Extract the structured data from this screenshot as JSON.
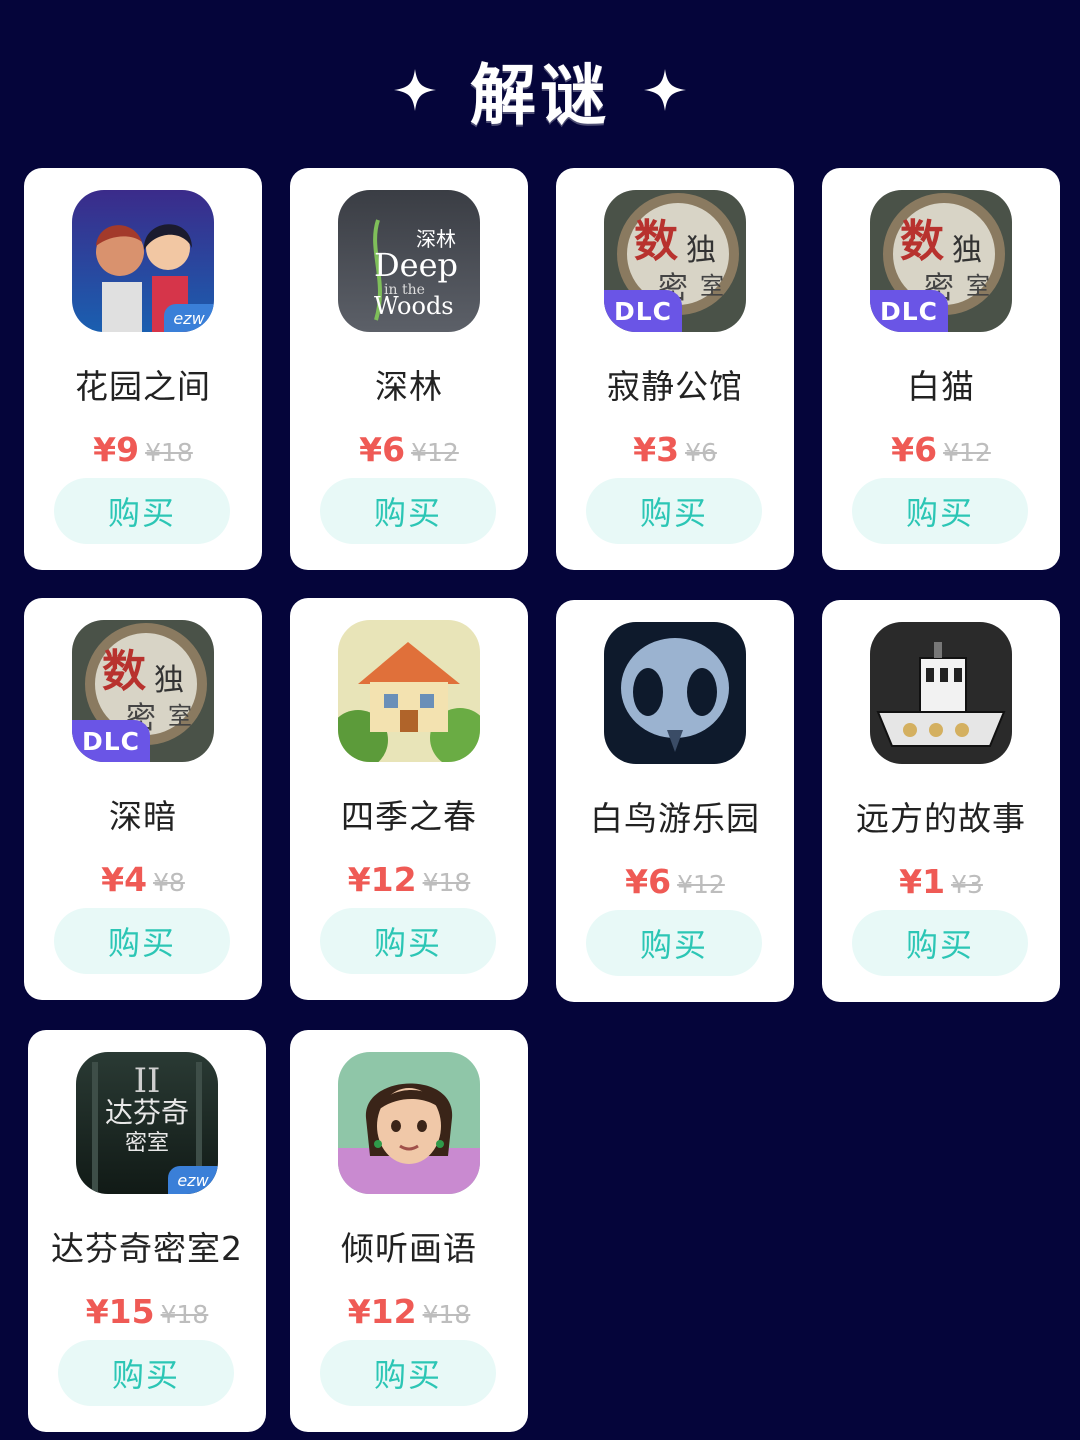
{
  "header": {
    "title": "解谜"
  },
  "buy_label": "购买",
  "colors": {
    "background": "#05053a",
    "price": "#ef5a55",
    "button_text": "#2cc6b5",
    "button_bg": "#e8f9f7",
    "dlc_badge": "#6a55e6"
  },
  "games": [
    {
      "name": "花园之间",
      "price": "¥9",
      "old_price": "¥18",
      "badge": "ezw",
      "icon": "garden-between-icon"
    },
    {
      "name": "深林",
      "price": "¥6",
      "old_price": "¥12",
      "badge": "",
      "icon": "deep-in-the-woods-icon",
      "icon_text": [
        "深林",
        "Deep",
        "in the",
        "Woods"
      ]
    },
    {
      "name": "寂静公馆",
      "price": "¥3",
      "old_price": "¥6",
      "badge": "DLC",
      "icon": "magnifier-puzzle-icon",
      "icon_text": [
        "数",
        "独",
        "密",
        "室"
      ]
    },
    {
      "name": "白猫",
      "price": "¥6",
      "old_price": "¥12",
      "badge": "DLC",
      "icon": "magnifier-puzzle-icon",
      "icon_text": [
        "数",
        "独",
        "密",
        "室"
      ]
    },
    {
      "name": "深暗",
      "price": "¥4",
      "old_price": "¥8",
      "badge": "DLC",
      "icon": "magnifier-puzzle-icon",
      "icon_text": [
        "数",
        "独",
        "密",
        "室"
      ]
    },
    {
      "name": "四季之春",
      "price": "¥12",
      "old_price": "¥18",
      "badge": "",
      "icon": "house-icon"
    },
    {
      "name": "白鸟游乐园",
      "price": "¥6",
      "old_price": "¥12",
      "badge": "",
      "icon": "bird-skull-icon"
    },
    {
      "name": "远方的故事",
      "price": "¥1",
      "old_price": "¥3",
      "badge": "",
      "icon": "boat-icon"
    },
    {
      "name": "达芬奇密室2",
      "price": "¥15",
      "old_price": "¥18",
      "badge": "ezw",
      "icon": "davinci-room-icon",
      "icon_text": [
        "达芬奇",
        "密室",
        "II"
      ]
    },
    {
      "name": "倾听画语",
      "price": "¥12",
      "old_price": "¥18",
      "badge": "",
      "icon": "girl-portrait-icon"
    }
  ]
}
